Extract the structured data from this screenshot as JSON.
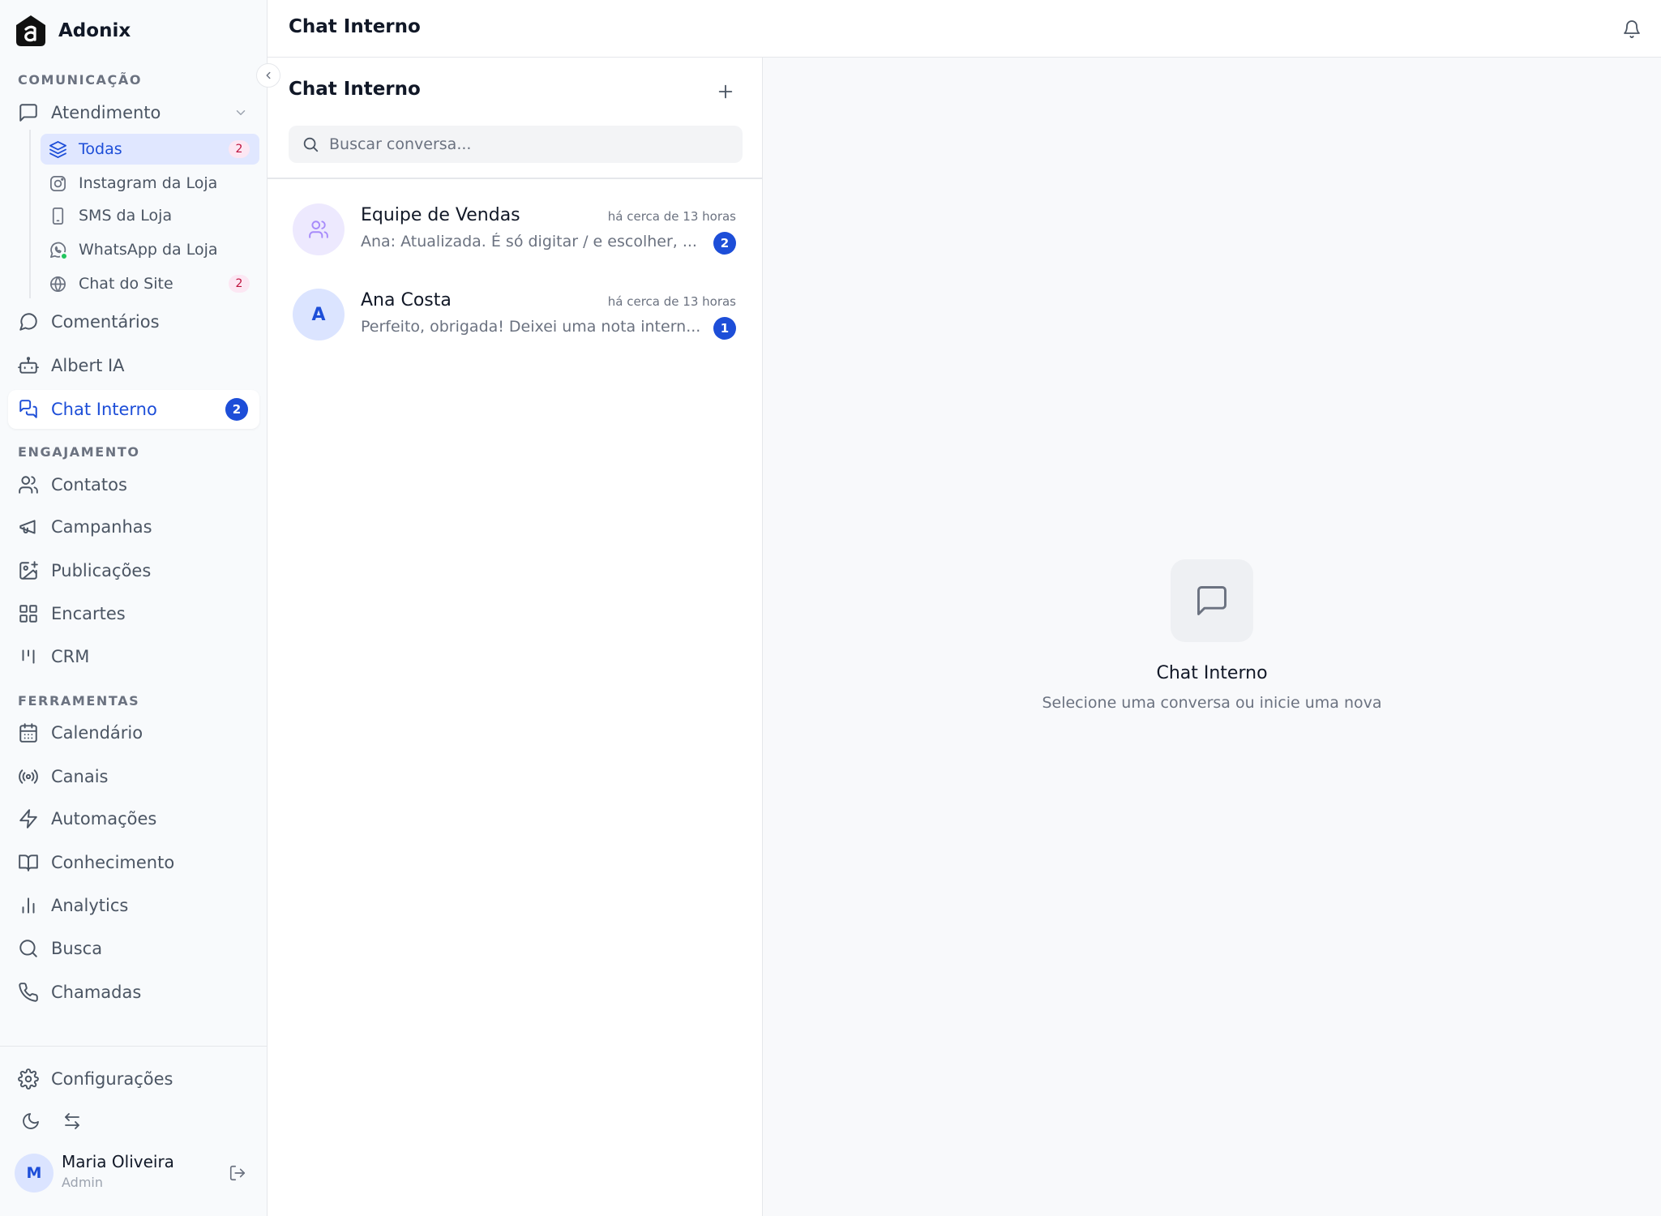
{
  "app": {
    "name": "Adonix"
  },
  "colors": {
    "accent": "#1d4ed8",
    "sidebar_bg": "#f8fafc",
    "badge_pink_bg": "#fce7f3",
    "badge_pink_text": "#be123c",
    "online": "#22c55e"
  },
  "sidebar": {
    "sections": {
      "comunicacao": "COMUNICAÇÃO",
      "engajamento": "ENGAJAMENTO",
      "ferramentas": "FERRAMENTAS"
    },
    "atendimento": {
      "label": "Atendimento",
      "icon": "message-square-icon",
      "children": [
        {
          "label": "Todas",
          "icon": "layers-icon",
          "badge": "2",
          "active": true
        },
        {
          "label": "Instagram da Loja",
          "icon": "instagram-icon"
        },
        {
          "label": "SMS da Loja",
          "icon": "smartphone-icon"
        },
        {
          "label": "WhatsApp da Loja",
          "icon": "whatsapp-icon",
          "online": true
        },
        {
          "label": "Chat do Site",
          "icon": "globe-icon",
          "badge": "2"
        }
      ]
    },
    "comentarios": {
      "label": "Comentários",
      "icon": "message-circle-icon"
    },
    "albert": {
      "label": "Albert IA",
      "icon": "bot-icon"
    },
    "chat_interno": {
      "label": "Chat Interno",
      "icon": "messages-icon",
      "badge": "2",
      "active": true
    },
    "contatos": {
      "label": "Contatos",
      "icon": "users-icon"
    },
    "campanhas": {
      "label": "Campanhas",
      "icon": "megaphone-icon"
    },
    "publicacoes": {
      "label": "Publicações",
      "icon": "image-plus-icon"
    },
    "encartes": {
      "label": "Encartes",
      "icon": "grid-icon"
    },
    "crm": {
      "label": "CRM",
      "icon": "kanban-icon"
    },
    "calendario": {
      "label": "Calendário",
      "icon": "calendar-icon"
    },
    "canais": {
      "label": "Canais",
      "icon": "radio-icon"
    },
    "automacoes": {
      "label": "Automações",
      "icon": "zap-icon"
    },
    "conhecimento": {
      "label": "Conhecimento",
      "icon": "book-open-icon"
    },
    "analytics": {
      "label": "Analytics",
      "icon": "bar-chart-icon"
    },
    "busca": {
      "label": "Busca",
      "icon": "search-icon"
    },
    "chamadas": {
      "label": "Chamadas",
      "icon": "phone-icon"
    },
    "configuracoes": {
      "label": "Configurações",
      "icon": "settings-icon"
    }
  },
  "user": {
    "initial": "M",
    "name": "Maria Oliveira",
    "role": "Admin"
  },
  "header": {
    "title": "Chat Interno"
  },
  "conversations_panel": {
    "title": "Chat Interno",
    "search_placeholder": "Buscar conversa...",
    "items": [
      {
        "name": "Equipe de Vendas",
        "time": "há cerca de 13 horas",
        "preview": "Ana: Atualizada. É só digitar / e escolher, ...",
        "unread": "2",
        "avatar_icon": "users-icon"
      },
      {
        "name": "Ana Costa",
        "time": "há cerca de 13 horas",
        "preview": "Perfeito, obrigada! Deixei uma nota intern...",
        "unread": "1",
        "avatar_initial": "A"
      }
    ]
  },
  "empty_state": {
    "icon": "message-square-icon",
    "title": "Chat Interno",
    "subtitle": "Selecione uma conversa ou inicie uma nova"
  }
}
